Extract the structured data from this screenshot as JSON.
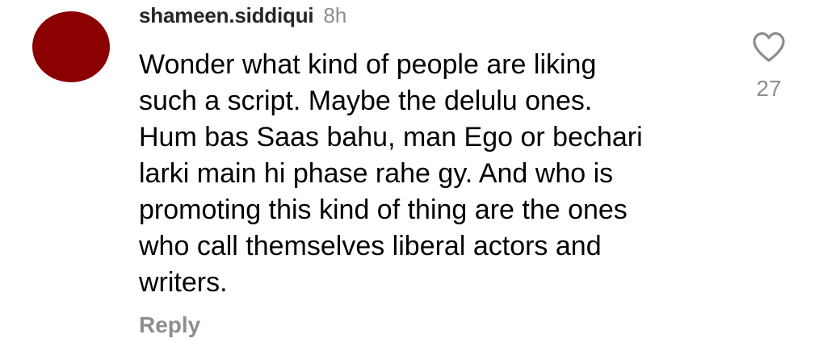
{
  "comment": {
    "username": "shameen.siddiqui",
    "timestamp": "8h",
    "text": "Wonder what kind of people are liking\nsuch a script. Maybe the delulu ones.\nHum bas Saas bahu, man Ego or bechari\nlarki main hi phase rahe gy. And who is\npromoting this kind of thing are the ones\nwho call themselves liberal actors and\nwriters.",
    "reply_label": "Reply",
    "like_count": "27",
    "avatar_color": "#8b0000",
    "like_icon": "heart-icon"
  }
}
